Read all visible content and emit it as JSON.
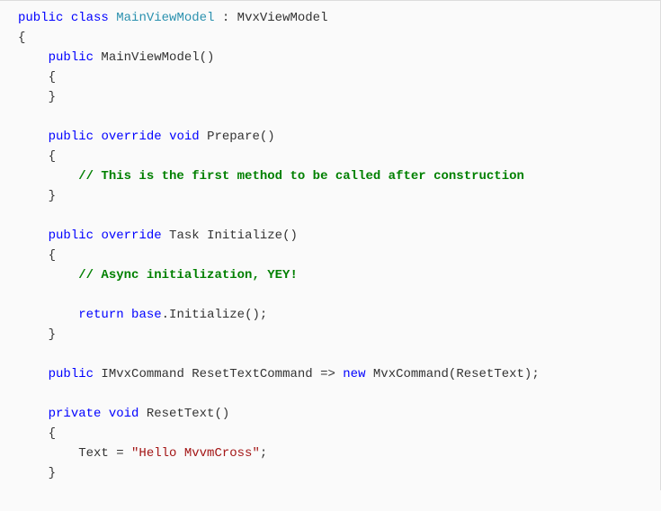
{
  "code": {
    "tokens": [
      [
        [
          "kw",
          "public"
        ],
        [
          "",
          ", "
        ],
        [
          "kw",
          "class"
        ],
        [
          "",
          " "
        ],
        [
          "type",
          "MainViewModel"
        ],
        [
          "",
          " : MvxViewModel"
        ]
      ],
      [
        [
          "",
          "{"
        ]
      ],
      [
        [
          "",
          "    "
        ],
        [
          "kw",
          "public"
        ],
        [
          "",
          " MainViewModel()"
        ]
      ],
      [
        [
          "",
          "    {"
        ]
      ],
      [
        [
          "",
          "    }"
        ]
      ],
      [
        [
          "",
          ""
        ]
      ],
      [
        [
          "",
          "    "
        ],
        [
          "kw",
          "public"
        ],
        [
          "",
          " "
        ],
        [
          "kw",
          "override"
        ],
        [
          "",
          " "
        ],
        [
          "kw",
          "void"
        ],
        [
          "",
          " Prepare()"
        ]
      ],
      [
        [
          "",
          "    {"
        ]
      ],
      [
        [
          "",
          "        "
        ],
        [
          "cmt",
          "// This is the first method to be called after construction"
        ]
      ],
      [
        [
          "",
          "    }"
        ]
      ],
      [
        [
          "",
          ""
        ]
      ],
      [
        [
          "",
          "    "
        ],
        [
          "kw",
          "public"
        ],
        [
          "",
          " "
        ],
        [
          "kw",
          "override"
        ],
        [
          "",
          " Task Initialize()"
        ]
      ],
      [
        [
          "",
          "    {"
        ]
      ],
      [
        [
          "",
          "        "
        ],
        [
          "cmt",
          "// Async initialization, YEY!"
        ]
      ],
      [
        [
          "",
          ""
        ]
      ],
      [
        [
          "",
          "        "
        ],
        [
          "kw",
          "return"
        ],
        [
          "",
          " "
        ],
        [
          "kw",
          "base"
        ],
        [
          "",
          ".Initialize();"
        ]
      ],
      [
        [
          "",
          "    }"
        ]
      ],
      [
        [
          "",
          ""
        ]
      ],
      [
        [
          "",
          "    "
        ],
        [
          "kw",
          "public"
        ],
        [
          "",
          " IMvxCommand ResetTextCommand => "
        ],
        [
          "kw",
          "new"
        ],
        [
          "",
          " MvxCommand(ResetText);"
        ]
      ],
      [
        [
          "",
          ""
        ]
      ],
      [
        [
          "",
          "    "
        ],
        [
          "kw",
          "private"
        ],
        [
          "",
          " "
        ],
        [
          "kw",
          "void"
        ],
        [
          "",
          " ResetText()"
        ]
      ],
      [
        [
          "",
          "    {"
        ]
      ],
      [
        [
          "",
          "        Text = "
        ],
        [
          "str",
          "\"Hello MvvmCross\""
        ],
        [
          "",
          ";"
        ]
      ],
      [
        [
          "",
          "    }"
        ]
      ]
    ]
  }
}
